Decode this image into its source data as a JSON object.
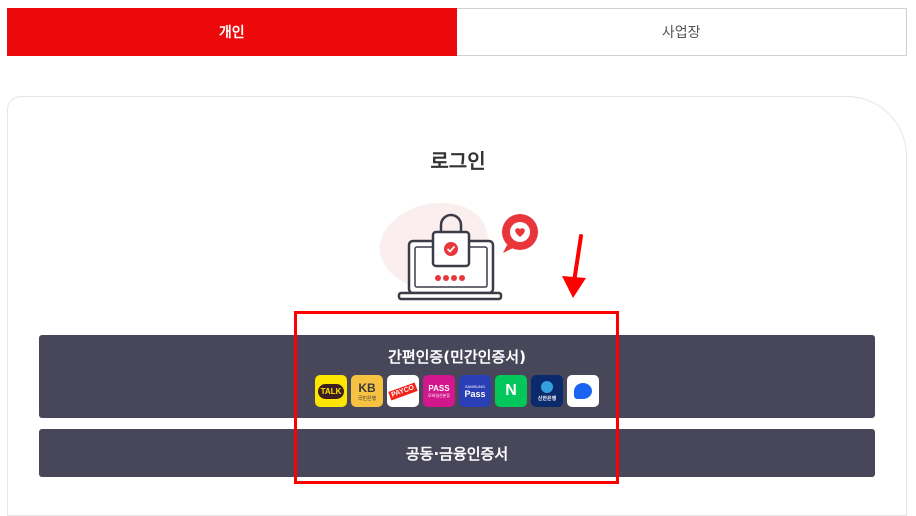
{
  "tabs": [
    {
      "label": "개인",
      "active": true
    },
    {
      "label": "사업장",
      "active": false
    }
  ],
  "login": {
    "title": "로그인",
    "simple_auth_label": "간편인증(민간인증서)",
    "joint_cert_label": "공동·금융인증서"
  },
  "auth_providers": [
    {
      "name": "kakao-talk-icon",
      "text": "TALK"
    },
    {
      "name": "kb-icon",
      "text": "KB",
      "sub": "국민은행"
    },
    {
      "name": "payco-icon",
      "text": "PAYCO"
    },
    {
      "name": "pass-icon",
      "text": "PASS",
      "sub": "모바일신분증"
    },
    {
      "name": "samsung-pass-icon",
      "text": "Pass",
      "sub": "SAMSUNG"
    },
    {
      "name": "naver-icon",
      "text": "N"
    },
    {
      "name": "shinhan-icon",
      "text": "신한은행"
    },
    {
      "name": "toss-icon",
      "text": ""
    }
  ],
  "colors": {
    "accent": "#ec0909",
    "button_bg": "#474759",
    "highlight": "#ff0000"
  }
}
